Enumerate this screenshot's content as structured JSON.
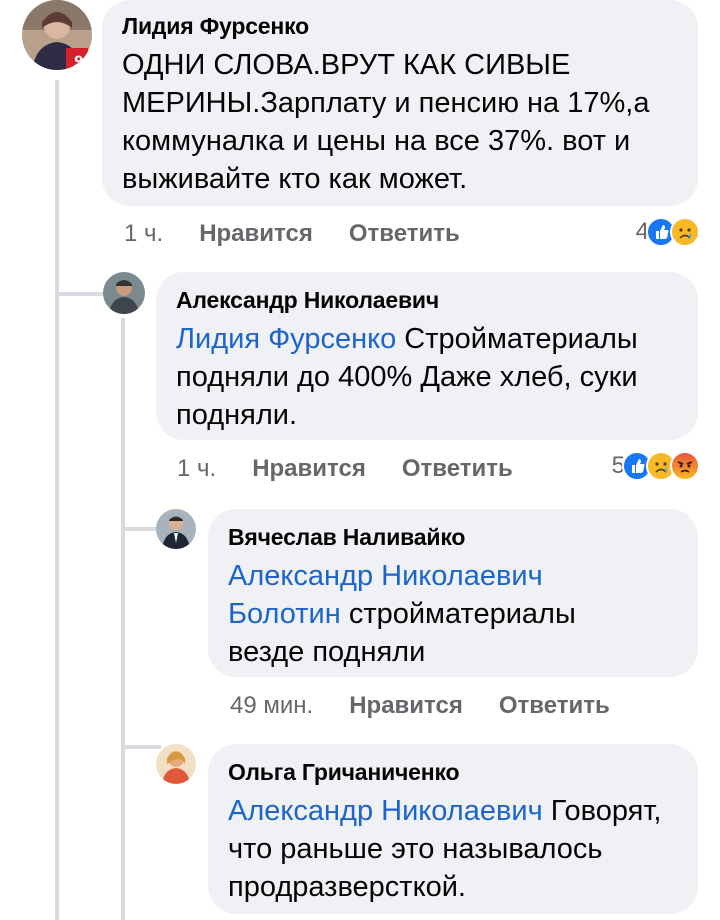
{
  "comments": [
    {
      "author": "Лидия Фурсенко",
      "mention": "",
      "text": "ОДНИ СЛОВА.ВРУТ КАК СИВЫЕ МЕРИНЫ.Зарплату и пенсию на 17%,а коммуналка и цены на все 37%. вот и выживайте кто как может.",
      "time": "1 ч.",
      "like_label": "Нравится",
      "reply_label": "Ответить",
      "reaction_count": "4",
      "reactions": [
        "like-reaction-icon",
        "sad-reaction-icon"
      ]
    },
    {
      "author": "Александр Николаевич",
      "mention": "Лидия Фурсенко",
      "text": " Стройматериалы подняли до 400% Даже хлеб, суки подняли.",
      "time": "1 ч.",
      "like_label": "Нравится",
      "reply_label": "Ответить",
      "reaction_count": "5",
      "reactions": [
        "like-reaction-icon",
        "sad-reaction-icon",
        "angry-reaction-icon"
      ]
    },
    {
      "author": "Вячеслав Наливайко",
      "mention": "Александр Николаевич Болотин",
      "text": " стройматериалы везде подняли",
      "time": "49 мин.",
      "like_label": "Нравится",
      "reply_label": "Ответить",
      "reaction_count": "",
      "reactions": []
    },
    {
      "author": "Ольга Гричаниченко",
      "mention": "Александр Николаевич",
      "text": " Говорят, что раньше это называлось продразверсткой.",
      "time": "",
      "like_label": "",
      "reply_label": "",
      "reaction_count": "",
      "reactions": []
    }
  ],
  "colors": {
    "bubble": "#eff1f4",
    "mention": "#1d65c9",
    "meta": "#65676b",
    "like": "#1877f2",
    "sad": "#f7b928",
    "angry": "#e8543a"
  }
}
